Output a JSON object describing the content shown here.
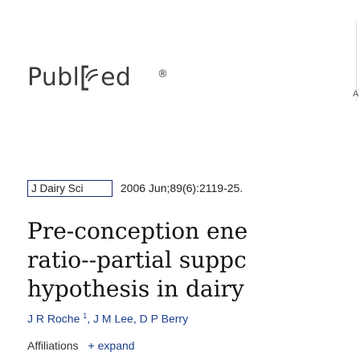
{
  "logo": {
    "left": "Publ",
    "right": "ed",
    "reg": "®"
  },
  "edge_mark": "A",
  "citation": {
    "journal": "J Dairy Sci",
    "details": "2006 Jun;89(6):2119-25."
  },
  "title_lines": [
    "Pre-conception ene",
    "ratio--partial suppc",
    "hypothesis in dairy"
  ],
  "authors": [
    {
      "name": "J R Roche",
      "sup": "1"
    },
    {
      "name": "J M Lee"
    },
    {
      "name": "D P Berry"
    }
  ],
  "affiliations": {
    "label": "Affiliations",
    "icon": "+",
    "action": "expand"
  },
  "colors": {
    "link": "#1a3e8c",
    "select_border": "#1c2b6e",
    "logo": "#3a3a3a"
  }
}
